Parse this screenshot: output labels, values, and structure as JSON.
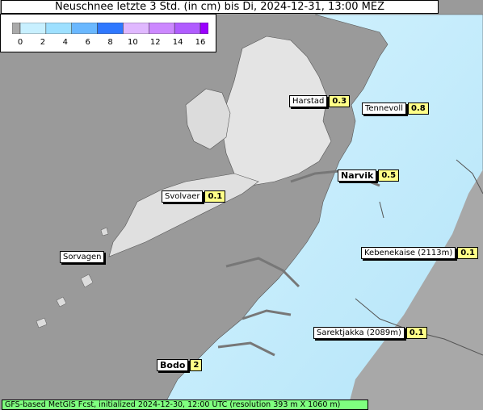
{
  "title": "Neuschnee letzte 3 Std. (in cm) bis Di, 2024-12-31, 13:00 MEZ",
  "legend": {
    "ticks": [
      "0",
      "2",
      "4",
      "6",
      "8",
      "10",
      "12",
      "14",
      "16"
    ],
    "colors": [
      "#aaaaaa",
      "#c8f0ff",
      "#9ee0ff",
      "#6ab8ff",
      "#2f78ff",
      "#e0b8ff",
      "#cc88ff",
      "#b05cff",
      "#9b00ff"
    ]
  },
  "cities": [
    {
      "name": "Harstad",
      "value": "0.3"
    },
    {
      "name": "Tennevoll",
      "value": "0.8"
    },
    {
      "name": "Narvik",
      "value": "0.5"
    },
    {
      "name": "Svolvaer",
      "value": "0.1"
    },
    {
      "name": "Sorvagen",
      "value": ""
    },
    {
      "name": "Kebenekaise (2113m)",
      "value": "0.1"
    },
    {
      "name": "Sarektjakka (2089m)",
      "value": "0.1"
    },
    {
      "name": "Bodo",
      "value": "2"
    }
  ],
  "footer": "GFS-based MetGIS Fcst, initialized 2024-12-30, 12:00 UTC  (resolution 393 m X 1060 m)",
  "colors": {
    "sea": "#9a9a9a",
    "land": "#d8d8d8",
    "snow_light": "#c8f0ff",
    "snow_mid": "#9ee0ff"
  }
}
